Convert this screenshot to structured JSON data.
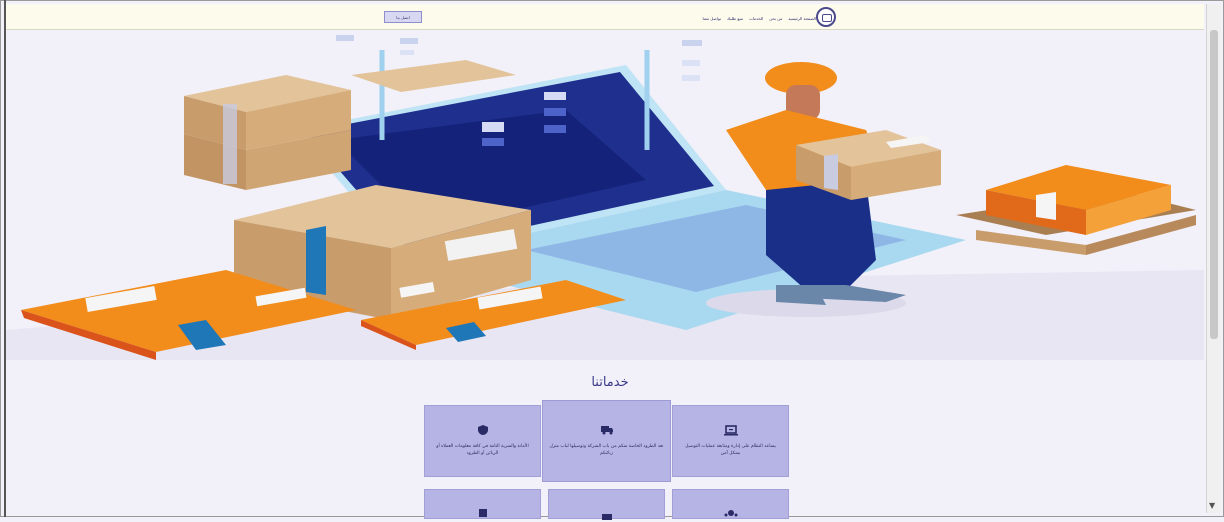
{
  "nav": {
    "contact_button": "اتصل بنا",
    "links": [
      "الصفحة الرئيسية",
      "من نحن",
      "الخدمات",
      "تتبع طلبك",
      "تواصل معنا"
    ]
  },
  "services": {
    "title": "خدماتنا",
    "cards": [
      {
        "icon": "shield-icon",
        "text": "الأمانة والسرية التامة في كافة معلومات العملاء أو الزبائن أو الطرود"
      },
      {
        "icon": "truck-icon",
        "text": "نعد الطرود الخاصة منكم من باب الشركة وتوصيلها لباب منزل زبائنكم"
      },
      {
        "icon": "laptop-icon",
        "text": "يساعد النظام على إدارة ومتابعة عمليات التوصيل بشكل آمن"
      }
    ]
  },
  "colors": {
    "page_bg": "#f2f0f8",
    "accent": "#3b3b8a",
    "card_bg": "#b6b4e4",
    "box_orange": "#f28c1a",
    "box_kraft": "#d6ad7a"
  }
}
